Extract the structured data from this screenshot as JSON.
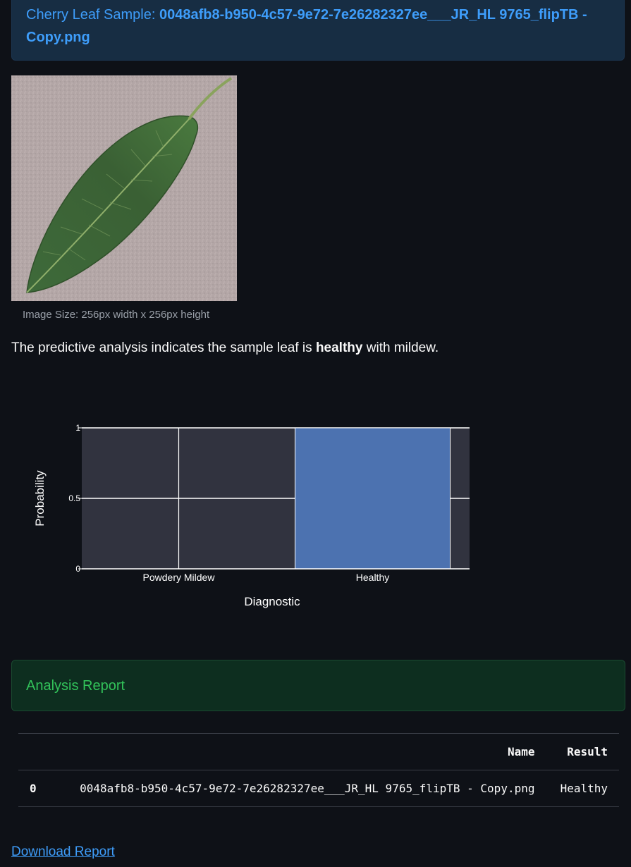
{
  "sample": {
    "prefix": "Cherry Leaf Sample:",
    "filename": "0048afb8-b950-4c57-9e72-7e26282327ee___JR_HL 9765_flipTB - Copy.png"
  },
  "image": {
    "caption": "Image Size: 256px width x 256px height"
  },
  "statement": {
    "before": "The predictive analysis indicates the sample leaf is ",
    "emphasis": "healthy",
    "after": " with mildew."
  },
  "chart_data": {
    "type": "bar",
    "categories": [
      "Powdery Mildew",
      "Healthy"
    ],
    "values": [
      0,
      1
    ],
    "xlabel": "Diagnostic",
    "ylabel": "Probability",
    "ylim": [
      0,
      1
    ],
    "yticks": [
      "0",
      "0.5",
      "1"
    ],
    "bar_color": "#4c72b0",
    "grid": true
  },
  "analysis": {
    "title": "Analysis Report"
  },
  "report_table": {
    "headers": [
      "",
      "Name",
      "Result"
    ],
    "rows": [
      [
        "0",
        "0048afb8-b950-4c57-9e72-7e26282327ee___JR_HL 9765_flipTB - Copy.png",
        "Healthy"
      ]
    ]
  },
  "download": {
    "label": "Download Report"
  }
}
